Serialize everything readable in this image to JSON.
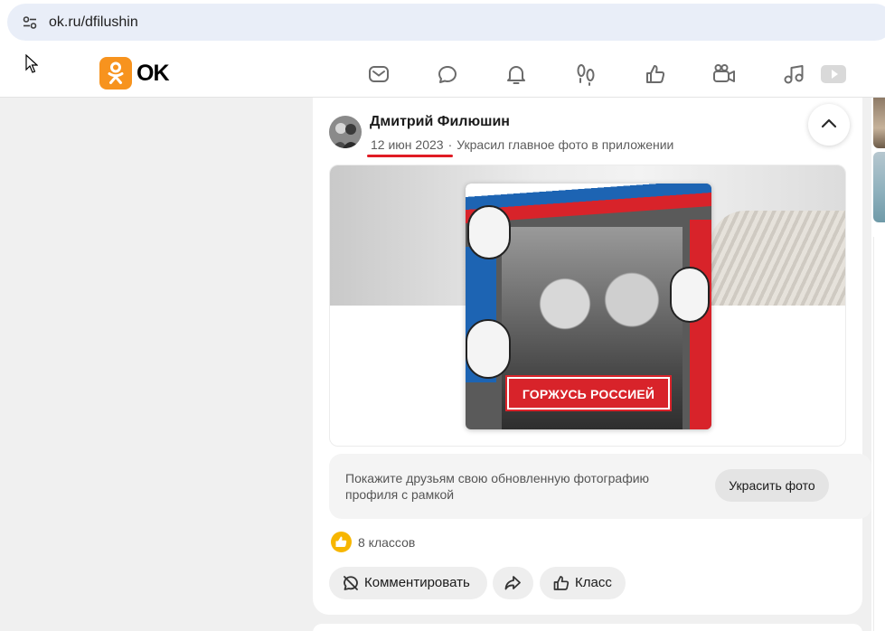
{
  "browser": {
    "url": "ok.ru/dfilushin",
    "site_info_icon": "tune-icon"
  },
  "header": {
    "logo_text": "OK",
    "logo_color": "#f7931e",
    "nav_icons": [
      "mail-icon",
      "chat-icon",
      "bell-icon",
      "footprints-icon",
      "thumbs-up-icon",
      "video-camera-icon",
      "music-icon",
      "video-play-icon"
    ]
  },
  "post": {
    "author": "Дмитрий Филюшин",
    "date": "12 июн 2023",
    "separator": "·",
    "action": "Украсил главное фото в приложении",
    "photo_banner": "ГОРЖУСЬ РОССИЕЙ",
    "promo_text": "Покажите друзьям свою обновленную фотографию профиля с рамкой",
    "promo_button": "Украсить фото",
    "likes_text": "8 классов",
    "actions": {
      "comment": "Комментировать",
      "klass": "Класс"
    },
    "accent_color": "#e01b24",
    "like_color": "#f7b600"
  }
}
